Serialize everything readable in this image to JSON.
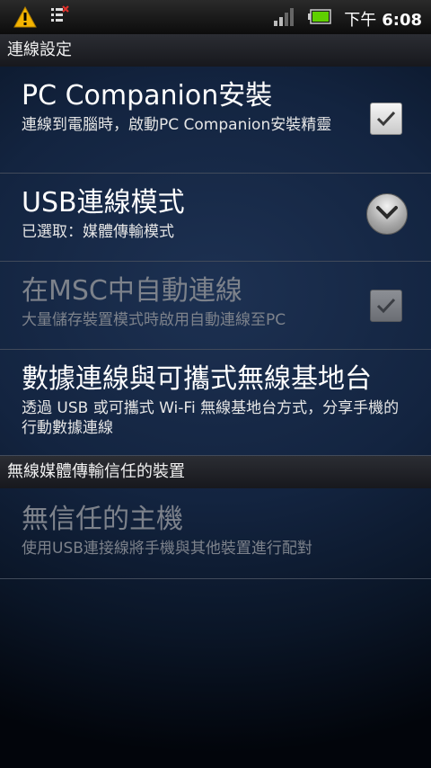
{
  "status_bar": {
    "time_prefix": "下午",
    "time": "6:08",
    "icons": [
      "warning-icon",
      "usb-debugging-icon",
      "signal-icon",
      "battery-icon"
    ]
  },
  "sections": [
    {
      "header": "連線設定",
      "items": [
        {
          "title": "PC Companion安裝",
          "summary": "連線到電腦時，啟動PC Companion安裝精靈",
          "control": "checkbox",
          "checked": true,
          "enabled": true
        },
        {
          "title": "USB連線模式",
          "summary": "已選取：媒體傳輸模式",
          "control": "chevron-down-icon",
          "enabled": true
        },
        {
          "title": "在MSC中自動連線",
          "summary": "大量儲存裝置模式時啟用自動連線至PC",
          "control": "checkbox",
          "checked": true,
          "enabled": false
        },
        {
          "title": "數據連線與可攜式無線基地台",
          "summary": "透過 USB 或可攜式 Wi-Fi 無線基地台方式，分享手機的行動數據連線",
          "enabled": true
        }
      ]
    },
    {
      "header": "無線媒體傳輸信任的裝置",
      "items": [
        {
          "title": "無信任的主機",
          "summary": "使用USB連接線將手機與其他裝置進行配對",
          "enabled": false
        }
      ]
    }
  ],
  "colors": {
    "background": "#132440",
    "disabled_text": "#7d828b",
    "divider": "#414a5a",
    "warning": "#f5b400"
  }
}
